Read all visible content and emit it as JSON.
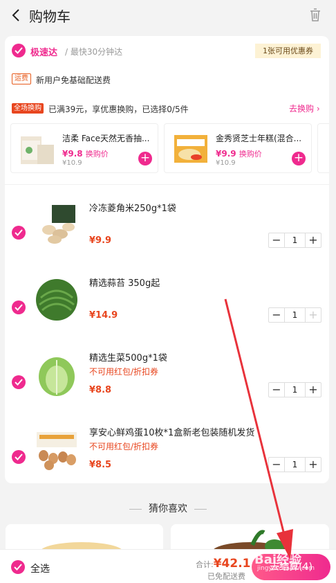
{
  "header": {
    "title": "购物车"
  },
  "store": {
    "name": "极速达",
    "time": "/ 最快30分钟达",
    "coupon": "1张可用优惠券",
    "fee_tag": "运费",
    "fee_text": "新用户免基础配送费"
  },
  "deal": {
    "tag": "全场换购",
    "text": "已满39元，享优惠换购，已选择0/5件",
    "action": "去换购 ›",
    "items": [
      {
        "name": "洁柔 Face天然无香抽...",
        "price": "¥9.8",
        "label": "换购价",
        "orig": "¥10.9"
      },
      {
        "name": "金秀贤芝士年糕(混合...",
        "price": "¥9.9",
        "label": "换购价",
        "orig": "¥10.9"
      }
    ]
  },
  "items": [
    {
      "name": "冷冻菱角米250g*1袋",
      "warn": "",
      "price": "¥9.9",
      "qty": "1"
    },
    {
      "name": "精选蒜苔 350g起",
      "warn": "",
      "price": "¥14.9",
      "qty": "1"
    },
    {
      "name": "精选生菜500g*1袋",
      "warn": "不可用红包/折扣券",
      "price": "¥8.8",
      "qty": "1"
    },
    {
      "name": "享安心鲜鸡蛋10枚*1盒新老包装随机发货",
      "warn": "不可用红包/折扣券",
      "price": "¥8.5",
      "qty": "1"
    }
  ],
  "guess": "猜你喜欢",
  "bottom": {
    "select_all": "全选",
    "total_label": "合计:",
    "total": "¥42.1",
    "free": "已免配送费",
    "pay": "去结算(4)"
  },
  "watermark": {
    "text": "Bai经验",
    "sub": "jingyan.baidu.com"
  },
  "colors": {
    "accent": "#ef2a8e",
    "price": "#e8461f",
    "annotation_arrow": "#e8323b"
  }
}
